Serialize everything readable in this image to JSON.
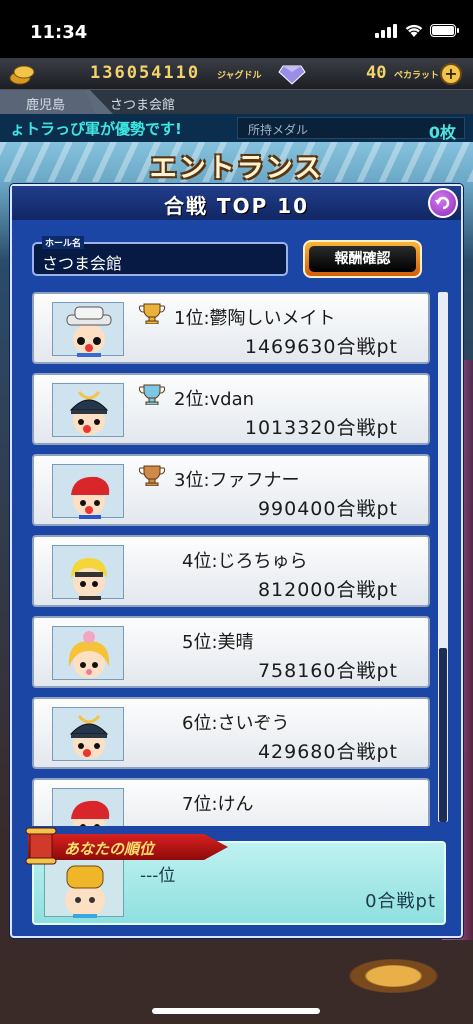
{
  "status_bar": {
    "time": "11:34"
  },
  "currency": {
    "coins": "136054110",
    "coin_unit": "ジャグドル",
    "gems": "40",
    "gem_unit": "ペカラット"
  },
  "breadcrumb": {
    "area": "鹿児島",
    "hall": "さつま会館"
  },
  "ticker": {
    "message": "ょトラっぴ軍が優勢です!",
    "medal_label": "所持メダル",
    "medal_value": "0枚"
  },
  "page": {
    "title": "エントランス"
  },
  "panel": {
    "title": "合戦 TOP 10",
    "hall_label": "ホール名",
    "hall_name": "さつま会館",
    "reward_button": "報酬確認"
  },
  "ranking": [
    {
      "rank": "1位",
      "name": "鬱陶しいメイト",
      "score": "1469630合戦pt",
      "trophy": "gold-trophy-icon",
      "avatar": "hat-character-avatar"
    },
    {
      "rank": "2位",
      "name": "vdan",
      "score": "1013320合戦pt",
      "trophy": "silver-trophy-icon",
      "avatar": "samurai-helmet-avatar"
    },
    {
      "rank": "3位",
      "name": "ファフナー",
      "score": "990400合戦pt",
      "trophy": "bronze-trophy-icon",
      "avatar": "red-hair-avatar"
    },
    {
      "rank": "4位",
      "name": "じろちゅら",
      "score": "812000合戦pt",
      "avatar": "blonde-character-avatar"
    },
    {
      "rank": "5位",
      "name": "美晴",
      "score": "758160合戦pt",
      "avatar": "pink-hair-avatar"
    },
    {
      "rank": "6位",
      "name": "さいぞう",
      "score": "429680合戦pt",
      "avatar": "samurai-helmet-avatar"
    },
    {
      "rank": "7位",
      "name": "けん",
      "score": "",
      "avatar": "red-hair-avatar"
    }
  ],
  "your_rank": {
    "title": "あなたの順位",
    "rank": "---位",
    "score": "0合戦pt"
  },
  "colors": {
    "panel": "#1c46a6",
    "accent": "#f2c54a",
    "ticker": "#3ee6e2"
  }
}
